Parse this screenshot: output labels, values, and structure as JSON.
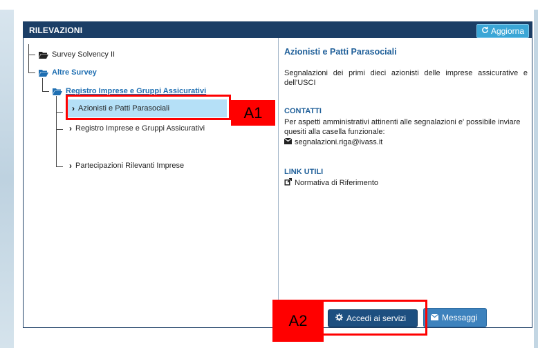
{
  "panel": {
    "title": "RILEVAZIONI",
    "refresh_label": "Aggiorna"
  },
  "tree": {
    "items": [
      {
        "label": "Survey Solvency II"
      },
      {
        "label": "Altre Survey"
      },
      {
        "label": "Registro Imprese e Gruppi Assicurativi"
      },
      {
        "label": "Azionisti e Patti Parasociali"
      },
      {
        "label": "Registro Imprese e Gruppi Assicurativi"
      },
      {
        "label": "Partecipazioni Rilevanti Imprese"
      }
    ]
  },
  "detail": {
    "title": "Azionisti e Patti Parasociali",
    "description": "Segnalazioni dei primi dieci azionisti delle imprese assicurative e dell'USCI",
    "contacts_heading": "CONTATTI",
    "contacts_text": "Per aspetti amministrativi attinenti alle segnalazioni e' possibile inviare quesiti alla casella funzionale:",
    "email": "segnalazioni.riga@ivass.it",
    "links_heading": "LINK UTILI",
    "link_label": "Normativa di Riferimento"
  },
  "actions": {
    "access_label": "Accedi ai servizi",
    "messages_label": "Messaggi"
  },
  "annotations": {
    "a1": "A1",
    "a2": "A2",
    "color": "#ff0000"
  },
  "colors": {
    "header": "#1b3e66",
    "accent": "#1f6fb2",
    "selected": "#b5e0f7"
  }
}
